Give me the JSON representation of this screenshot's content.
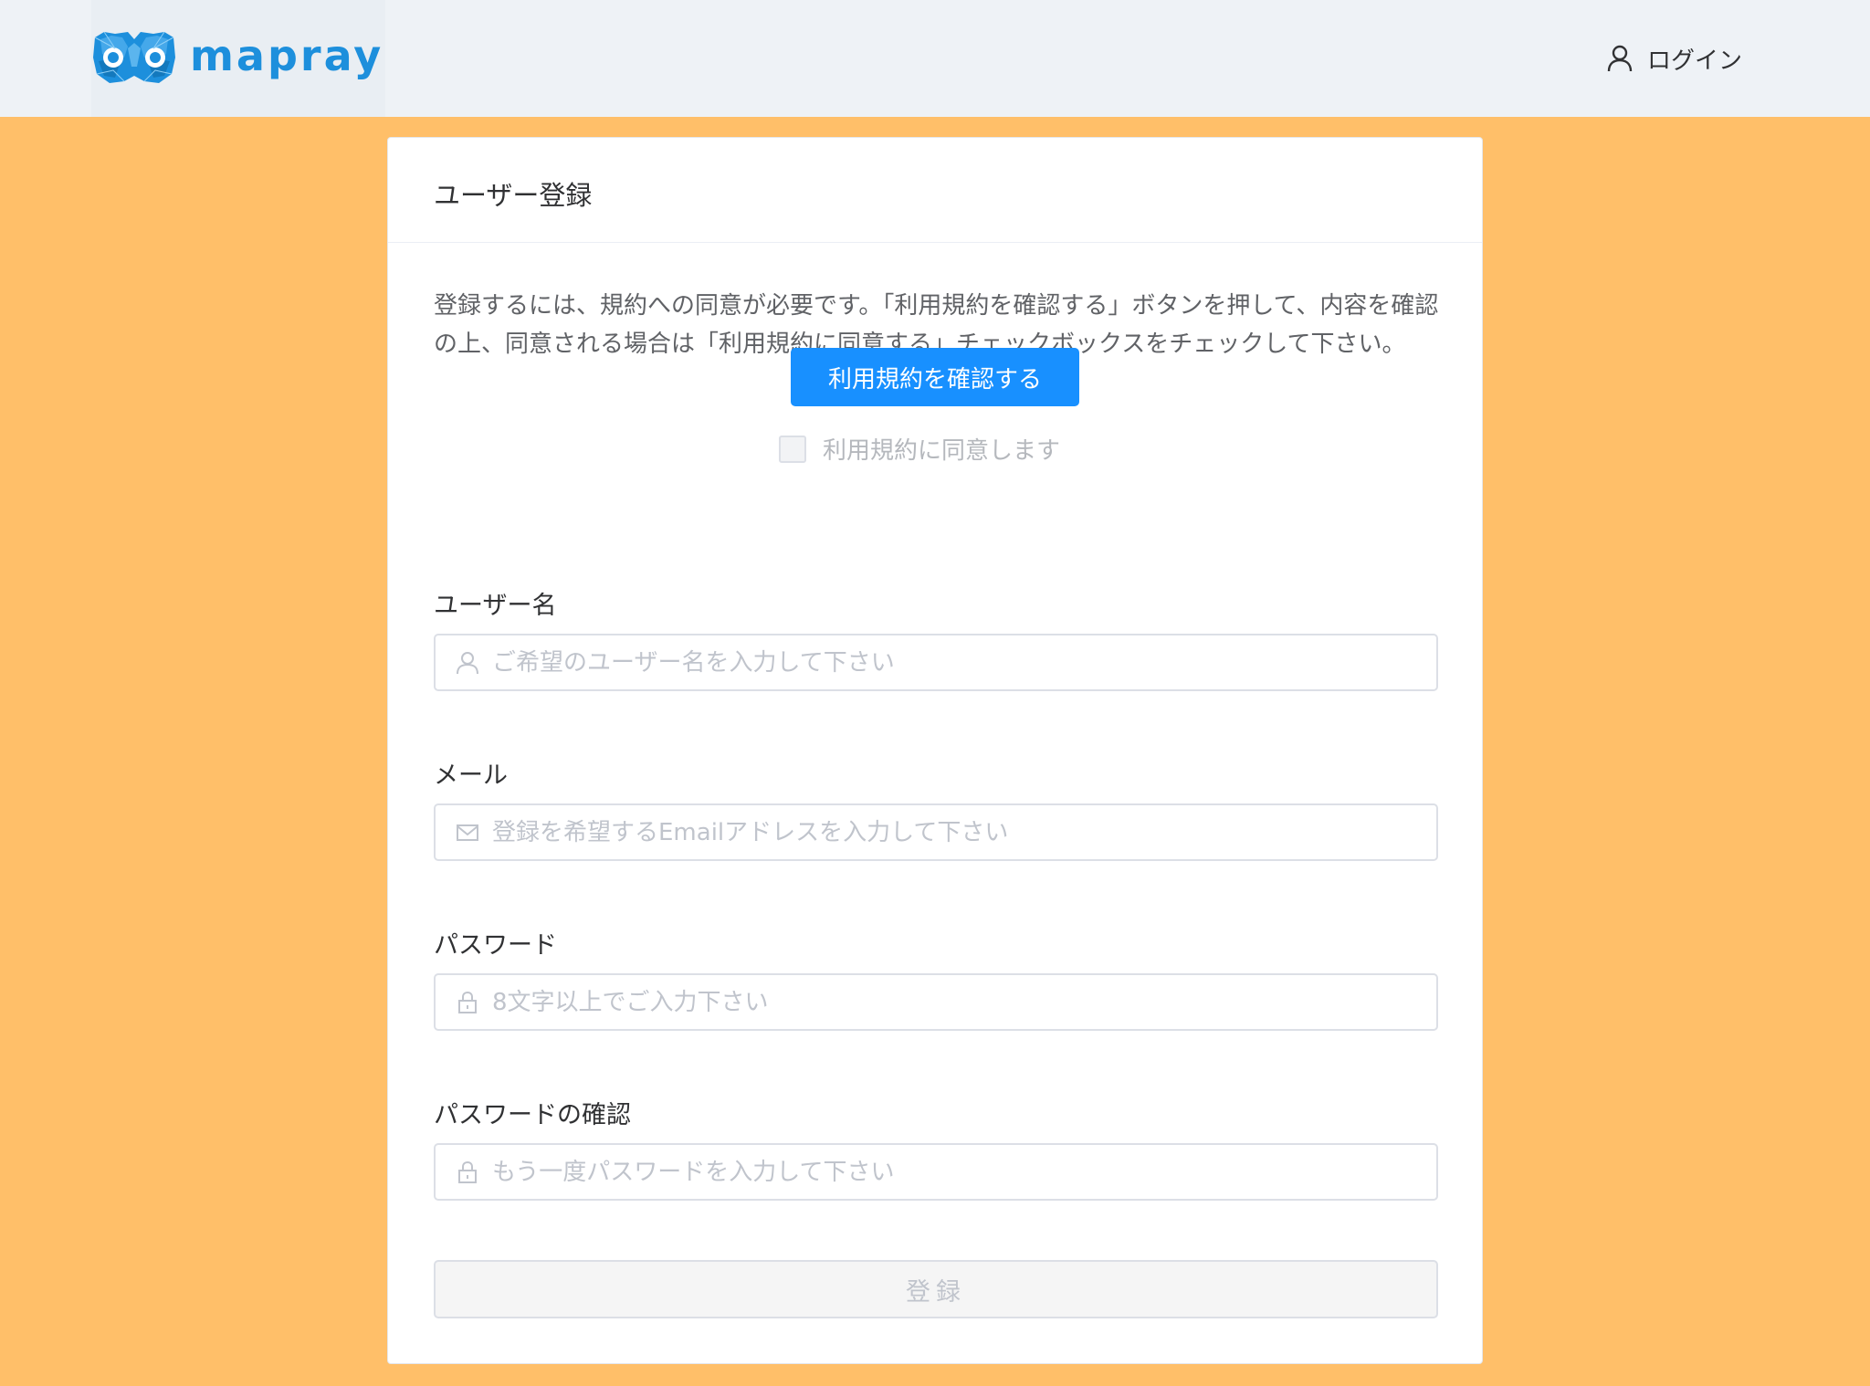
{
  "header": {
    "brand": "mapray",
    "login_label": "ログイン",
    "login_icon": "user-icon"
  },
  "card": {
    "title": "ユーザー登録",
    "notice": "登録するには、規約への同意が必要です。「利用規約を確認する」ボタンを押して、内容を確認の上、同意される場合は「利用規約に同意する」チェックボックスをチェックして下さい。",
    "terms_button": "利用規約を確認する",
    "agree_label": "利用規約に同意します",
    "agree_checked": false,
    "fields": [
      {
        "label": "ユーザー名",
        "placeholder": "ご希望のユーザー名を入力して下さい",
        "icon": "user-icon",
        "value": ""
      },
      {
        "label": "メール",
        "placeholder": "登録を希望するEmailアドレスを入力して下さい",
        "icon": "mail-icon",
        "value": ""
      },
      {
        "label": "パスワード",
        "placeholder": "8文字以上でご入力下さい",
        "icon": "lock-icon",
        "value": ""
      },
      {
        "label": "パスワードの確認",
        "placeholder": "もう一度パスワードを入力して下さい",
        "icon": "lock-icon",
        "value": ""
      }
    ],
    "submit_label": "登録",
    "submit_disabled": true
  },
  "colors": {
    "page_background": "#ffbf69",
    "header_background": "#eef2f6",
    "brand": "#1d8fdc",
    "primary_button": "#1890ff"
  }
}
